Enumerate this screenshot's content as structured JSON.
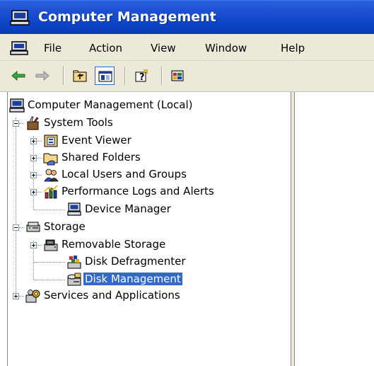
{
  "window": {
    "title": "Computer Management"
  },
  "menu": {
    "items": [
      {
        "label": "File"
      },
      {
        "label": "Action"
      },
      {
        "label": "View"
      },
      {
        "label": "Window"
      },
      {
        "label": "Help"
      }
    ]
  },
  "toolbar": {
    "buttons": [
      "back-arrow-icon",
      "forward-arrow-icon",
      "up-one-level-icon",
      "show-hide-tree-icon",
      "help-icon",
      "export-list-icon"
    ]
  },
  "tree": {
    "root": {
      "label": "Computer Management (Local)",
      "icon": "computer-icon"
    },
    "system_tools": {
      "label": "System Tools",
      "icon": "tools-icon",
      "expanded": true,
      "children": [
        {
          "label": "Event Viewer",
          "icon": "event-viewer-icon"
        },
        {
          "label": "Shared Folders",
          "icon": "shared-folder-icon"
        },
        {
          "label": "Local Users and Groups",
          "icon": "users-icon"
        },
        {
          "label": "Performance Logs and Alerts",
          "icon": "performance-icon"
        },
        {
          "label": "Device Manager",
          "icon": "device-manager-icon"
        }
      ]
    },
    "storage": {
      "label": "Storage",
      "icon": "storage-icon",
      "expanded": true,
      "children": [
        {
          "label": "Removable Storage",
          "icon": "removable-storage-icon"
        },
        {
          "label": "Disk Defragmenter",
          "icon": "defragmenter-icon"
        },
        {
          "label": "Disk Management",
          "icon": "disk-management-icon",
          "selected": true
        }
      ]
    },
    "services": {
      "label": "Services and Applications",
      "icon": "services-icon",
      "expanded": false
    }
  },
  "colors": {
    "title_bar": "#0b43c8",
    "chrome": "#ece9d8",
    "selection": "#316ac5"
  }
}
